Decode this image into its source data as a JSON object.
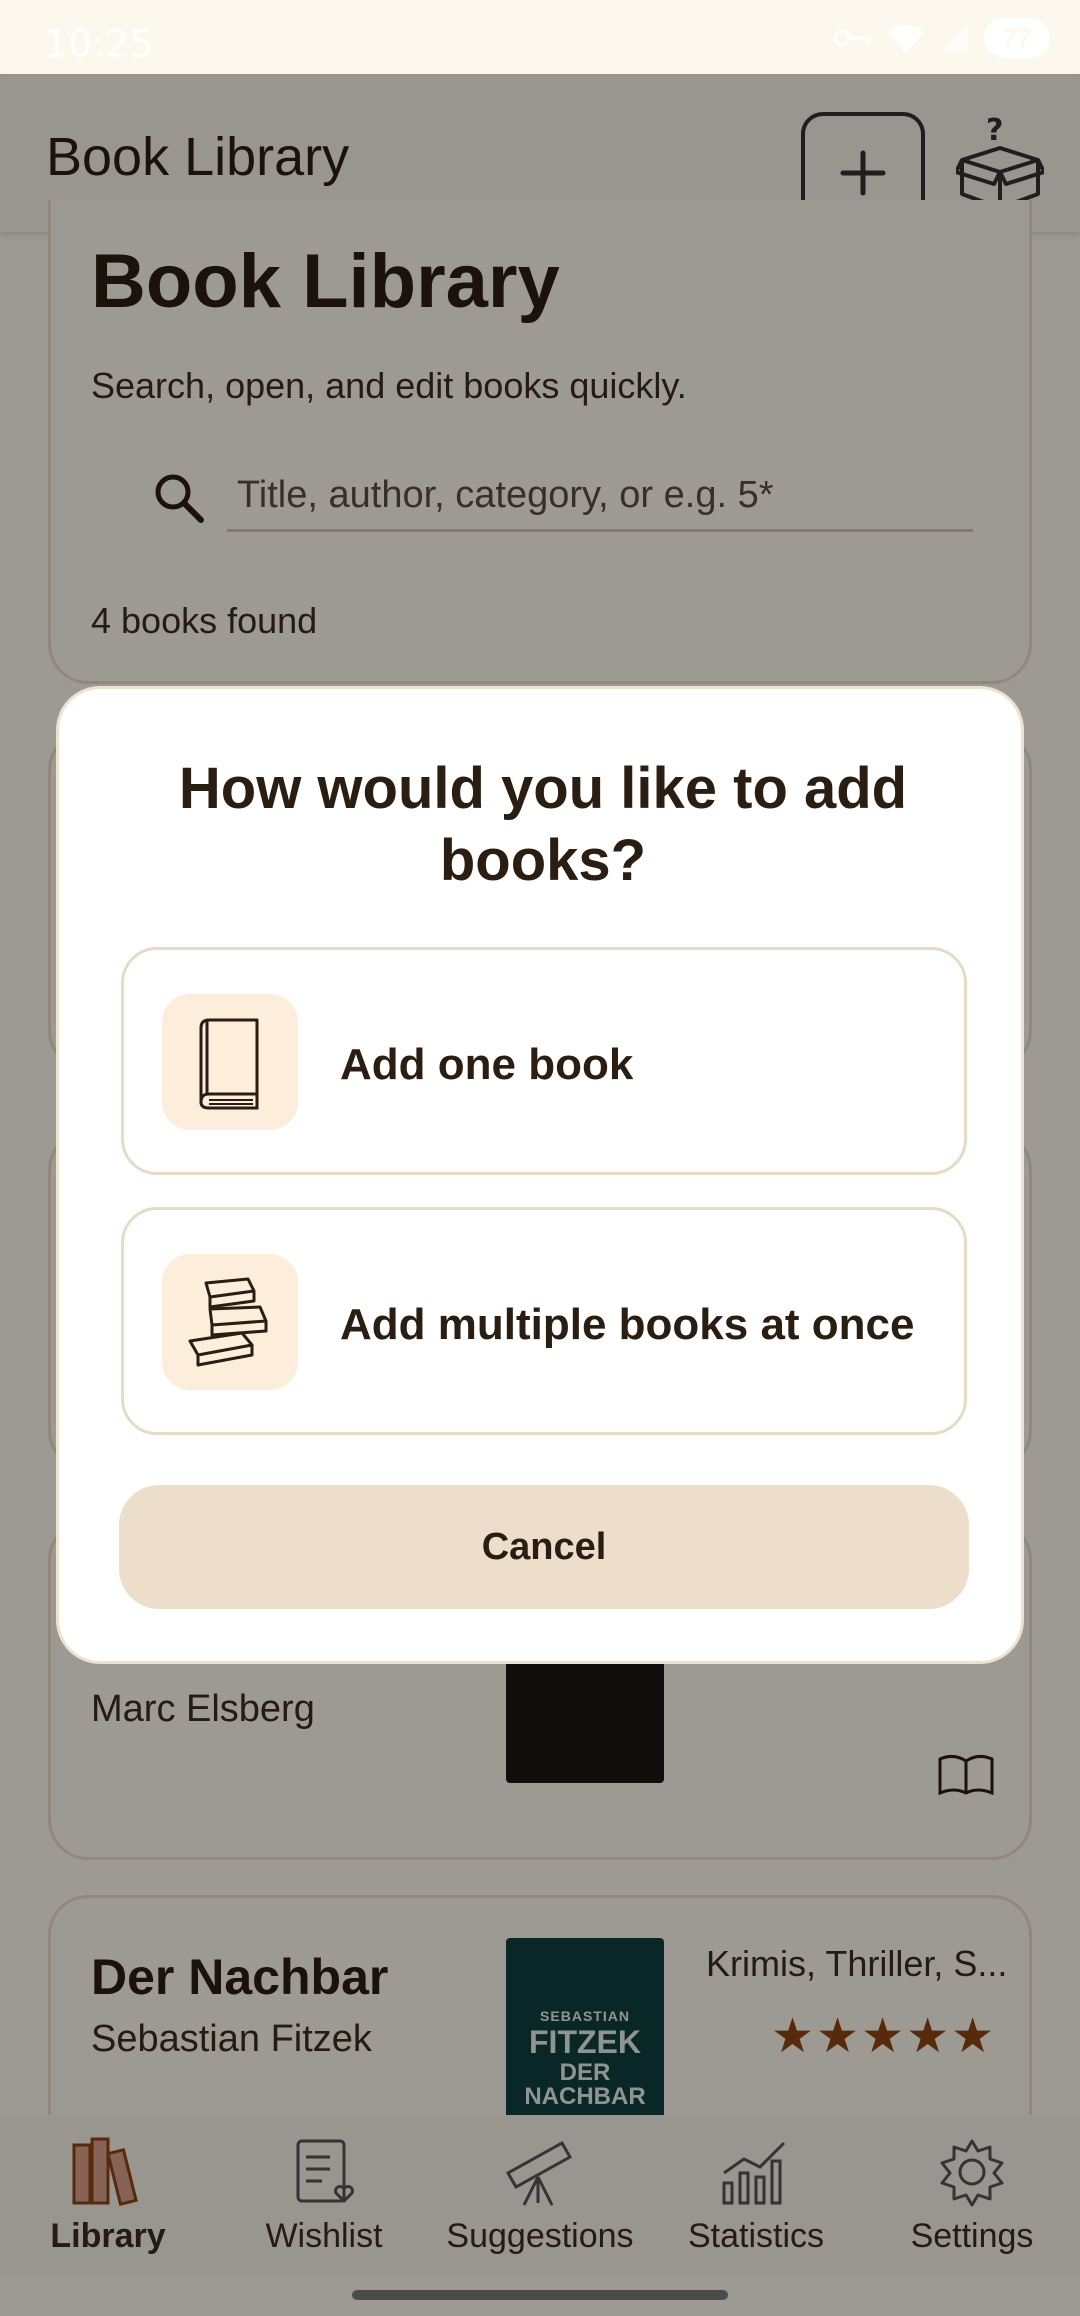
{
  "status_bar": {
    "time": "10:25",
    "battery": "77"
  },
  "app_bar": {
    "title": "Book Library"
  },
  "header": {
    "title": "Book Library",
    "subtitle": "Search, open, and edit books quickly.",
    "search_placeholder": "Title, author, category, or e.g. 5*",
    "count": "4 books found"
  },
  "books": [
    {
      "author": "Marc Elsberg"
    },
    {
      "title": "Der Nachbar",
      "author": "Sebastian Fitzek",
      "category": "Krimis, Thriller, S...",
      "rating": 5,
      "stars": "★★★★★",
      "cover": {
        "line1": "SEBASTIAN",
        "line2": "FITZEK",
        "line3": "DER NACHBAR"
      }
    }
  ],
  "dialog": {
    "title": "How would you like to add books?",
    "options": [
      {
        "label": "Add one book",
        "icon": "single-book-icon"
      },
      {
        "label": "Add multiple books at once",
        "icon": "stacked-books-icon"
      }
    ],
    "cancel_label": "Cancel"
  },
  "nav": [
    {
      "label": "Library",
      "icon": "library-icon",
      "active": true
    },
    {
      "label": "Wishlist",
      "icon": "wishlist-icon",
      "active": false
    },
    {
      "label": "Suggestions",
      "icon": "telescope-icon",
      "active": false
    },
    {
      "label": "Statistics",
      "icon": "statistics-icon",
      "active": false
    },
    {
      "label": "Settings",
      "icon": "gear-icon",
      "active": false
    }
  ],
  "colors": {
    "accent": "#8b4513",
    "background": "#fdf8ee",
    "option_icon_bg": "#fdeedb",
    "cancel_bg": "#ecdecb"
  }
}
